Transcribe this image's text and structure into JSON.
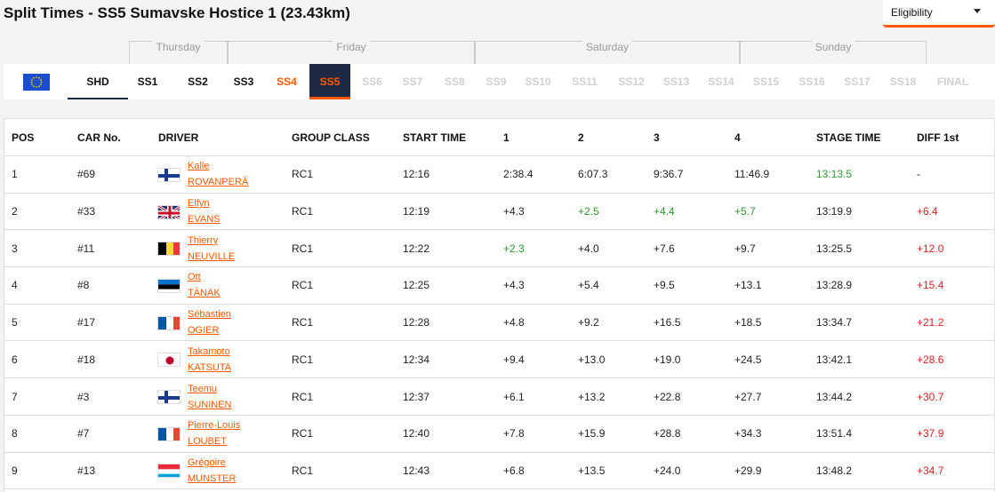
{
  "title": "Split Times - SS5 Sumavske Hostice 1 (23.43km)",
  "eligibility": {
    "label": "Eligibility",
    "icon": "chevron-down-icon"
  },
  "days": [
    "Thursday",
    "Friday",
    "Saturday",
    "Sunday"
  ],
  "tabs": {
    "flag_icon": "eu-flag-icon",
    "items": [
      "SHD",
      "SS1",
      "SS2",
      "SS3",
      "SS4",
      "SS5",
      "SS6",
      "SS7",
      "SS8",
      "SS9",
      "SS10",
      "SS11",
      "SS12",
      "SS13",
      "SS14",
      "SS15",
      "SS16",
      "SS17",
      "SS18",
      "FINAL"
    ],
    "active": "SS5",
    "warning": "SS4",
    "disabled_from": "SS6"
  },
  "colors": {
    "accent": "#ff5a00",
    "navy": "#1e2a44",
    "positive": "#2a9a2a",
    "negative": "#e02020"
  },
  "columns": [
    "POS",
    "CAR No.",
    "DRIVER",
    "GROUP CLASS",
    "START TIME",
    "1",
    "2",
    "3",
    "4",
    "STAGE TIME",
    "DIFF 1st"
  ],
  "rows": [
    {
      "pos": "1",
      "car": "#69",
      "first": "Kalle",
      "last": "ROVANPERÄ",
      "flag": "finland-flag-icon",
      "cls": "RC1",
      "start": "12:16",
      "s1": "2:38.4",
      "s2": "6:07.3",
      "s3": "9:36.7",
      "s4": "11:46.9",
      "stage": "13:13.5",
      "diff": "-"
    },
    {
      "pos": "2",
      "car": "#33",
      "first": "Elfyn",
      "last": "EVANS",
      "flag": "uk-flag-icon",
      "cls": "RC1",
      "start": "12:19",
      "s1": "+4.3",
      "s2": "+2.5",
      "s3": "+4.4",
      "s4": "+5.7",
      "stage": "13:19.9",
      "diff": "+6.4"
    },
    {
      "pos": "3",
      "car": "#11",
      "first": "Thierry",
      "last": "NEUVILLE",
      "flag": "belgium-flag-icon",
      "cls": "RC1",
      "start": "12:22",
      "s1": "+2.3",
      "s2": "+4.0",
      "s3": "+7.6",
      "s4": "+9.7",
      "stage": "13:25.5",
      "diff": "+12.0"
    },
    {
      "pos": "4",
      "car": "#8",
      "first": "Ott",
      "last": "TÄNAK",
      "flag": "estonia-flag-icon",
      "cls": "RC1",
      "start": "12:25",
      "s1": "+4.3",
      "s2": "+5.4",
      "s3": "+9.5",
      "s4": "+13.1",
      "stage": "13:28.9",
      "diff": "+15.4"
    },
    {
      "pos": "5",
      "car": "#17",
      "first": "Sébastien",
      "last": "OGIER",
      "flag": "france-flag-icon",
      "cls": "RC1",
      "start": "12:28",
      "s1": "+4.8",
      "s2": "+9.2",
      "s3": "+16.5",
      "s4": "+18.5",
      "stage": "13:34.7",
      "diff": "+21.2"
    },
    {
      "pos": "6",
      "car": "#18",
      "first": "Takamoto",
      "last": "KATSUTA",
      "flag": "japan-flag-icon",
      "cls": "RC1",
      "start": "12:34",
      "s1": "+9.4",
      "s2": "+13.0",
      "s3": "+19.0",
      "s4": "+24.5",
      "stage": "13:42.1",
      "diff": "+28.6"
    },
    {
      "pos": "7",
      "car": "#3",
      "first": "Teemu",
      "last": "SUNINEN",
      "flag": "finland-flag-icon",
      "cls": "RC1",
      "start": "12:37",
      "s1": "+6.1",
      "s2": "+13.2",
      "s3": "+22.8",
      "s4": "+27.7",
      "stage": "13:44.2",
      "diff": "+30.7"
    },
    {
      "pos": "8",
      "car": "#7",
      "first": "Pierre-Louis",
      "last": "LOUBET",
      "flag": "france-flag-icon",
      "cls": "RC1",
      "start": "12:40",
      "s1": "+7.8",
      "s2": "+15.9",
      "s3": "+28.8",
      "s4": "+34.3",
      "stage": "13:51.4",
      "diff": "+37.9"
    },
    {
      "pos": "9",
      "car": "#13",
      "first": "Grégoire",
      "last": "MUNSTER",
      "flag": "luxembourg-flag-icon",
      "cls": "RC1",
      "start": "12:43",
      "s1": "+6.8",
      "s2": "+13.5",
      "s3": "+24.0",
      "s4": "+29.9",
      "stage": "13:48.2",
      "diff": "+34.7"
    }
  ]
}
